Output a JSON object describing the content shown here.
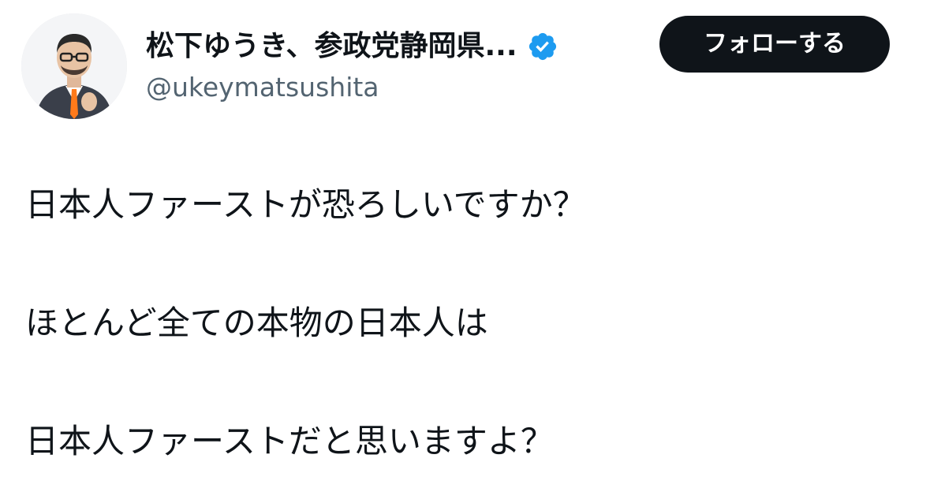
{
  "author": {
    "display_name": "松下ゆうき、参政党静岡県...",
    "handle": "@ukeymatsushita",
    "verified": true,
    "verified_color": "#1d9bf0",
    "avatar_icon": "profile-photo"
  },
  "follow_button": {
    "label": "フォローする",
    "background": "#0f1419",
    "text_color": "#ffffff"
  },
  "tweet": {
    "lines": [
      "日本人ファーストが恐ろしいですか？",
      "ほとんど全ての本物の日本人は",
      "日本人ファーストだと思いますよ？"
    ]
  },
  "colors": {
    "text_primary": "#0f1419",
    "text_secondary": "#536471",
    "background": "#ffffff"
  }
}
